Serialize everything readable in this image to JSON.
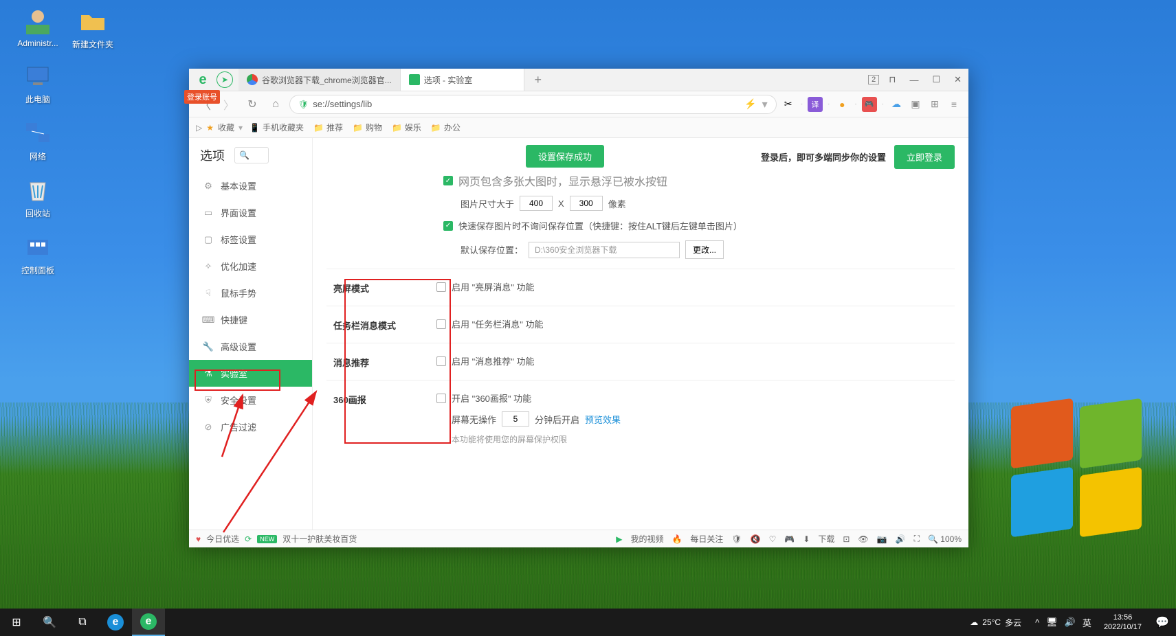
{
  "desktop": {
    "icons": [
      {
        "label": "Administr...",
        "icon": "user"
      },
      {
        "label": "此电脑",
        "icon": "pc"
      },
      {
        "label": "网络",
        "icon": "network"
      },
      {
        "label": "回收站",
        "icon": "trash"
      },
      {
        "label": "控制面板",
        "icon": "control"
      }
    ],
    "folder": {
      "label": "新建文件夹"
    }
  },
  "account_badge": "登录账号",
  "titlebar": {
    "tabs": [
      {
        "label": "谷歌浏览器下载_chrome浏览器官..."
      },
      {
        "label": "选项 - 实验室"
      }
    ],
    "tab_count": "2"
  },
  "addressbar": {
    "url": "se://settings/lib"
  },
  "bookmarks": {
    "fav": "收藏",
    "items": [
      "手机收藏夹",
      "推荐",
      "购物",
      "娱乐",
      "办公"
    ]
  },
  "sidebar": {
    "title": "选项",
    "items": [
      {
        "label": "基本设置"
      },
      {
        "label": "界面设置"
      },
      {
        "label": "标签设置"
      },
      {
        "label": "优化加速"
      },
      {
        "label": "鼠标手势"
      },
      {
        "label": "快捷键"
      },
      {
        "label": "高级设置"
      },
      {
        "label": "实验室"
      },
      {
        "label": "安全设置"
      },
      {
        "label": "广告过滤"
      }
    ]
  },
  "banner": "设置保存成功",
  "sync": {
    "text": "登录后，即可多端同步你的设置",
    "button": "立即登录"
  },
  "settings": {
    "partial_top": {
      "cut_text": "网页包含多张大图时，显示悬浮已被水按钮",
      "size_label": "图片尺寸大于",
      "width": "400",
      "sep": "X",
      "height": "300",
      "unit": "像素",
      "quicksave": "快速保存图片时不询问保存位置（快捷键：按住ALT键后左键单击图片）",
      "path_label": "默认保存位置：",
      "path_value": "D:\\360安全浏览器下载",
      "change": "更改..."
    },
    "bright": {
      "title": "亮屏模式",
      "opt": "启用 \"亮屏消息\" 功能"
    },
    "taskbar_msg": {
      "title": "任务栏消息模式",
      "opt": "启用 \"任务栏消息\" 功能"
    },
    "push": {
      "title": "消息推荐",
      "opt": "启用 \"消息推荐\" 功能"
    },
    "pictorial": {
      "title": "360画报",
      "opt": "开启 \"360画报\" 功能",
      "idle_label": "屏幕无操作",
      "idle_value": "5",
      "idle_suffix": "分钟后开启",
      "preview": "预览效果",
      "note": "本功能将使用您的屏幕保护权限"
    }
  },
  "statusbar": {
    "today": "今日优选",
    "promo": "双十一护肤美妆百货",
    "video": "我的视频",
    "daily": "每日关注",
    "download": "下载",
    "zoom": "100%"
  },
  "taskbar": {
    "weather_temp": "25°C",
    "weather_desc": "多云",
    "ime": "英",
    "time": "13:56",
    "date": "2022/10/17"
  }
}
